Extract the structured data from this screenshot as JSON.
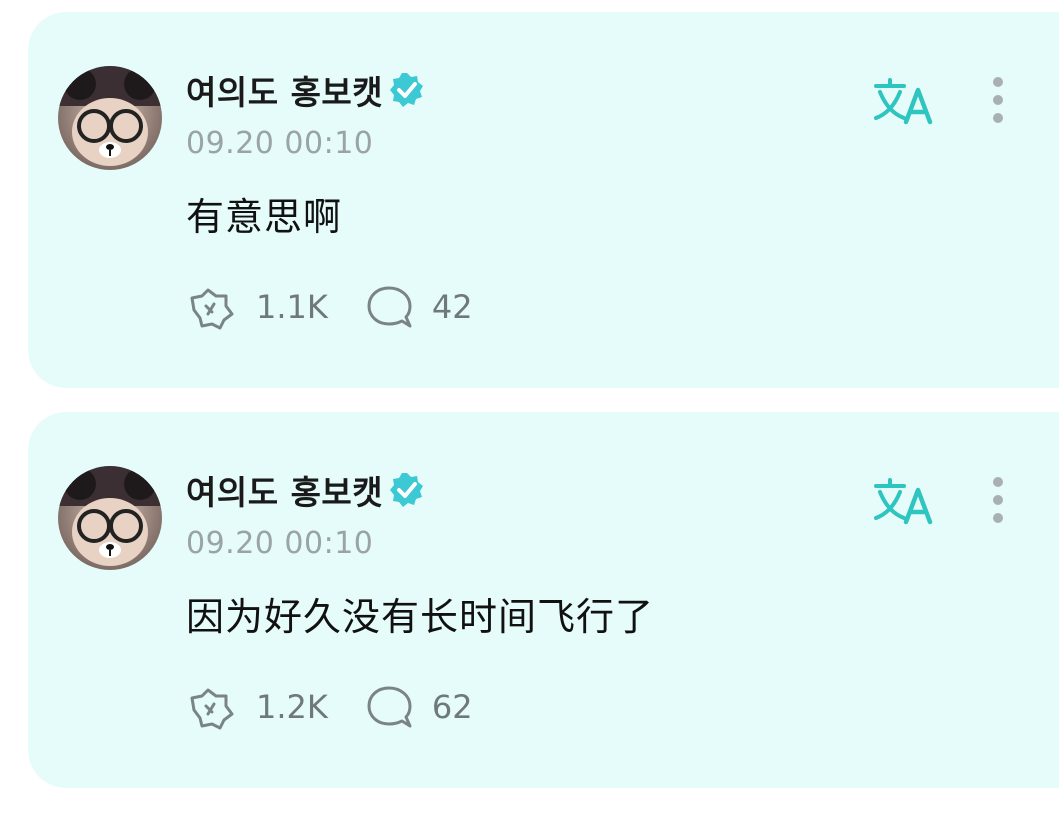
{
  "colors": {
    "card_background": "#e6fcfa",
    "accent": "#2ec4bf",
    "verified_badge": "#3cc9d4",
    "muted_text": "#9aa3a6"
  },
  "posts": [
    {
      "author": "여의도 홍보캣",
      "verified": true,
      "timestamp": "09.20 00:10",
      "content": "有意思啊",
      "reactions_count": "1.1K",
      "replies_count": "42",
      "icons": [
        "avatar",
        "verified-badge-icon",
        "translate-icon",
        "more-vertical-icon",
        "reaction-icon",
        "reply-bubble-icon"
      ]
    },
    {
      "author": "여의도 홍보캣",
      "verified": true,
      "timestamp": "09.20 00:10",
      "content": "因为好久没有长时间飞行了",
      "reactions_count": "1.2K",
      "replies_count": "62",
      "icons": [
        "avatar",
        "verified-badge-icon",
        "translate-icon",
        "more-vertical-icon",
        "reaction-icon",
        "reply-bubble-icon"
      ]
    }
  ]
}
